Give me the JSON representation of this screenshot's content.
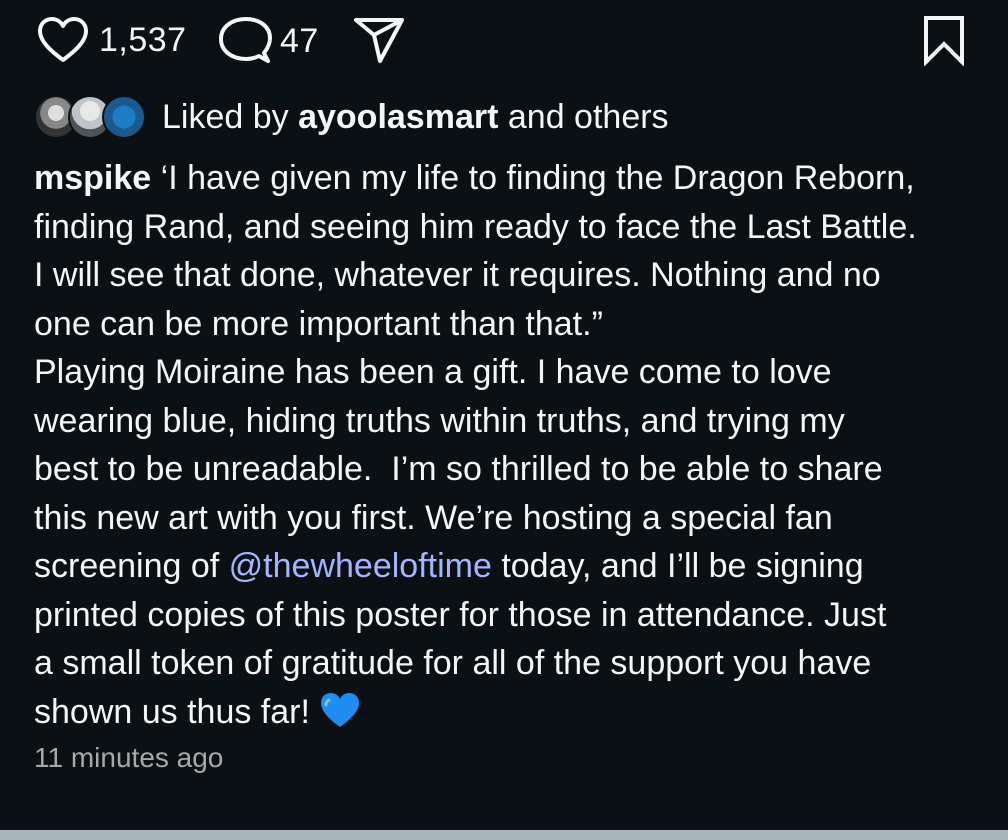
{
  "actions": {
    "like_count": "1,537",
    "comment_count": "47",
    "icons": {
      "like": "heart-outline-icon",
      "comment": "comment-bubble-icon",
      "share": "paper-plane-icon",
      "save": "bookmark-icon"
    }
  },
  "liked_by": {
    "prefix": "Liked by",
    "username": "ayoolasmart",
    "suffix": "and others"
  },
  "caption": {
    "username": "mspike",
    "lines": [
      " ‘I have given my life to finding the Dragon Reborn,",
      "finding Rand, and seeing him ready to face the Last Battle.",
      "I will see that done, whatever it requires. Nothing and no",
      "one can be more important than that.”",
      "Playing Moiraine has been a gift. I have come to love",
      "wearing blue, hiding truths within truths, and trying my",
      "best to be unreadable.  I’m so thrilled to be able to share",
      "this new art with you first. We’re hosting a special fan",
      "screening of ",
      "printed copies of this poster for those in attendance. Just",
      "a small token of gratitude for all of the support you have",
      "shown us thus far! "
    ],
    "mention": "@thewheeloftime",
    "after_mention": " today, and I’ll be signing",
    "emoji": "blue-heart-emoji"
  },
  "timestamp": "11 minutes ago",
  "colors": {
    "background": "#0b1014",
    "text": "#f5f5f5",
    "mention": "#a5b5ff",
    "timestamp": "#a8a8a8",
    "blue_heart": "#1f8df2"
  }
}
